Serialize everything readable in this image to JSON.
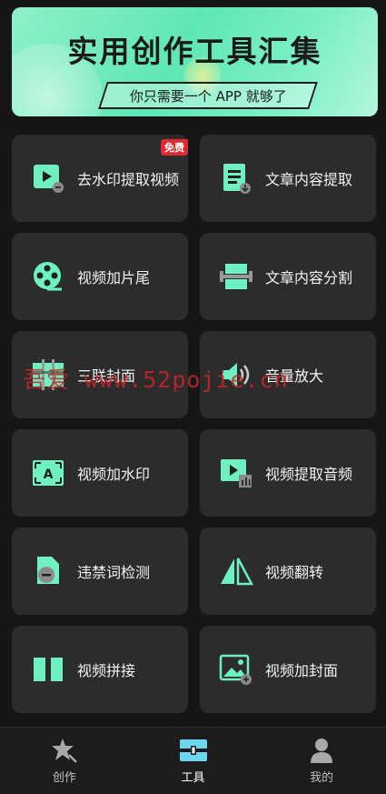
{
  "banner": {
    "title": "实用创作工具汇集",
    "subtitle": "你只需要一个 APP 就够了"
  },
  "tools": [
    {
      "label": "去水印提取视频",
      "badge": "免费"
    },
    {
      "label": "文章内容提取"
    },
    {
      "label": "视频加片尾"
    },
    {
      "label": "文章内容分割"
    },
    {
      "label": "三联封面"
    },
    {
      "label": "音量放大"
    },
    {
      "label": "视频加水印"
    },
    {
      "label": "视频提取音频"
    },
    {
      "label": "违禁词检测"
    },
    {
      "label": "视频翻转"
    },
    {
      "label": "视频拼接"
    },
    {
      "label": "视频加封面"
    }
  ],
  "watermark": "吾爱  www.52pojie.cn",
  "tabbar": [
    {
      "label": "创作",
      "icon": "star-icon"
    },
    {
      "label": "工具",
      "icon": "toolbox-icon",
      "active": true
    },
    {
      "label": "我的",
      "icon": "user-icon"
    }
  ],
  "colors": {
    "accent": "#6ef0c0",
    "card": "#2c2c2c",
    "badge": "#e32a32",
    "background": "#161616"
  }
}
